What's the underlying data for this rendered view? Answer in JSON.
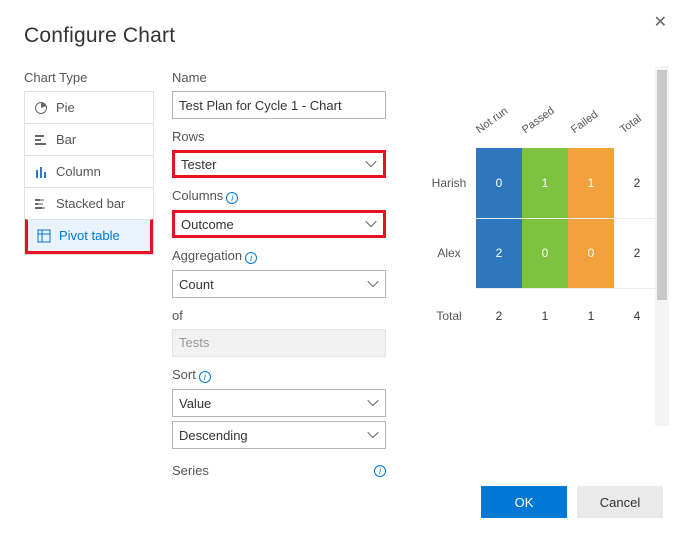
{
  "title": "Configure Chart",
  "chart_type_label": "Chart Type",
  "types": {
    "pie": "Pie",
    "bar": "Bar",
    "column": "Column",
    "stacked": "Stacked bar",
    "pivot": "Pivot table"
  },
  "form": {
    "name_label": "Name",
    "name_value": "Test Plan for Cycle 1 - Chart",
    "rows_label": "Rows",
    "rows_value": "Tester",
    "columns_label": "Columns",
    "columns_value": "Outcome",
    "aggregation_label": "Aggregation",
    "aggregation_value": "Count",
    "of_label": "of",
    "of_value": "Tests",
    "sort_label": "Sort",
    "sort_by": "Value",
    "sort_dir": "Descending",
    "series_label": "Series"
  },
  "buttons": {
    "ok": "OK",
    "cancel": "Cancel"
  },
  "chart_data": {
    "type": "table",
    "col_headers": [
      "Not run",
      "Passed",
      "Failed",
      "Total"
    ],
    "row_headers": [
      "Harish",
      "Alex"
    ],
    "values": [
      [
        0,
        1,
        1,
        2
      ],
      [
        2,
        0,
        0,
        2
      ]
    ],
    "totals_label": "Total",
    "col_totals": [
      2,
      1,
      1,
      4
    ],
    "colors": {
      "Not run": "#2e77bd",
      "Passed": "#7ec242",
      "Failed": "#f2a23c"
    }
  }
}
